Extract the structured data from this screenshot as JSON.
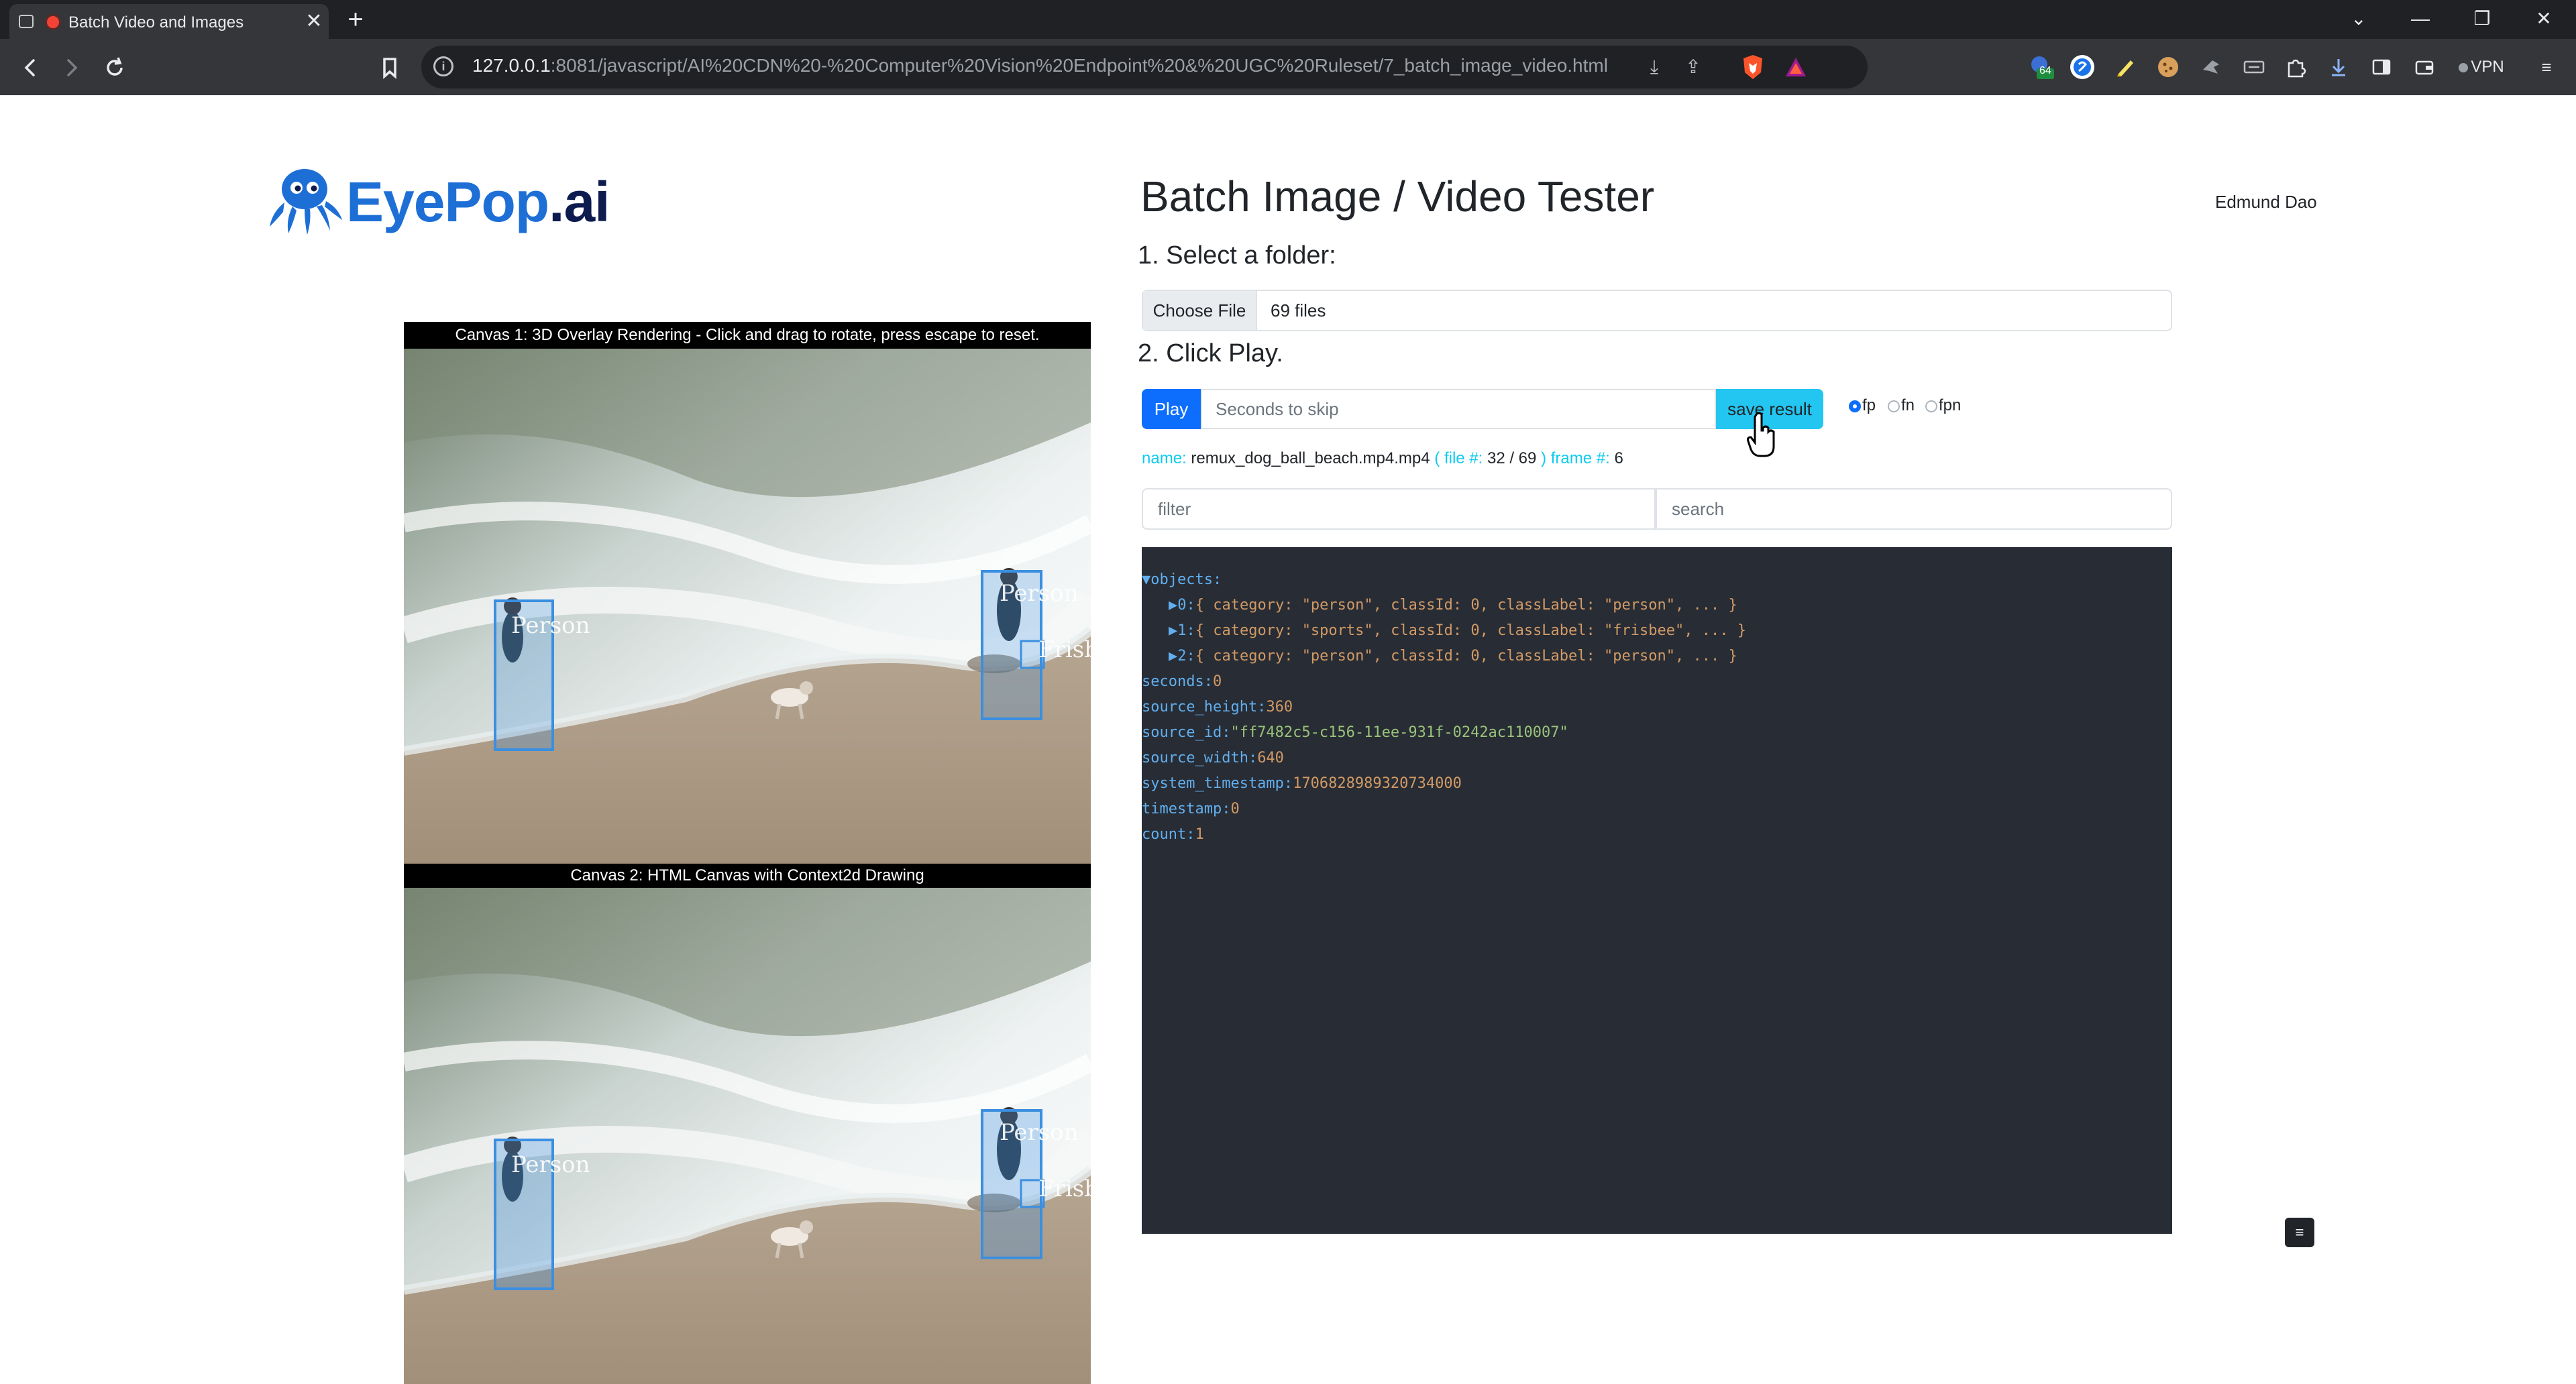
{
  "browser": {
    "tab_title": "Batch Video and Images",
    "tab_close": "✕",
    "new_tab": "+",
    "url_host": "127.0.0.1",
    "url_rest": ":8081/javascript/AI%20CDN%20-%20Computer%20Vision%20Endpoint%20&%20UGC%20Ruleset/7_batch_image_video.html",
    "info_icon": "i",
    "extension_badge": "64",
    "vpn_label": "VPN",
    "window_controls": [
      "⌄",
      "—",
      "❐",
      "✕"
    ],
    "accent_record": "#f44336"
  },
  "page": {
    "logo_eye": "EyePop",
    "logo_ai": ".ai",
    "title": "Batch Image / Video Tester",
    "user_name": "Edmund Dao",
    "step1": "1. Select a folder:",
    "choose_file": "Choose File",
    "file_count": "69 files",
    "step2": "2. Click Play.",
    "play_label": "Play",
    "skip_placeholder": "Seconds to skip",
    "save_label": "save result",
    "radios": [
      {
        "label": "fp",
        "checked": true
      },
      {
        "label": "fn",
        "checked": false
      },
      {
        "label": "fpn",
        "checked": false
      }
    ],
    "status": {
      "name_key": "name:",
      "name_val": "remux_dog_ball_beach.mp4.mp4",
      "file_open": "( file #:",
      "file_val": "32 / 69",
      "file_close": ")",
      "frame_key": "frame #:",
      "frame_val": "6"
    },
    "filter_placeholder": "filter",
    "search_placeholder": "search",
    "canvas1_label": "Canvas 1: 3D Overlay Rendering - Click and drag to rotate, press escape to reset.",
    "canvas2_label": "Canvas 2: HTML Canvas with Context2d Drawing",
    "overlay_labels": [
      "Person",
      "Person",
      "Frisbee"
    ],
    "scroll_button": "≡"
  },
  "json_view": {
    "objects_key": "▼objects:",
    "objects": [
      {
        "idx": "▶0:",
        "body": "{ category: \"person\", classId: 0, classLabel: \"person\", ... }"
      },
      {
        "idx": "▶1:",
        "body": "{ category: \"sports\", classId: 0, classLabel: \"frisbee\", ... }"
      },
      {
        "idx": "▶2:",
        "body": "{ category: \"person\", classId: 0, classLabel: \"person\", ... }"
      }
    ],
    "fields": [
      {
        "key": "seconds:",
        "val": "0",
        "kind": "num"
      },
      {
        "key": "source_height:",
        "val": "360",
        "kind": "num"
      },
      {
        "key": "source_id:",
        "val": "\"ff7482c5-c156-11ee-931f-0242ac110007\"",
        "kind": "str"
      },
      {
        "key": "source_width:",
        "val": "640",
        "kind": "num"
      },
      {
        "key": "system_timestamp:",
        "val": "1706828989320734000",
        "kind": "num"
      },
      {
        "key": "timestamp:",
        "val": "0",
        "kind": "num"
      },
      {
        "key": "count:",
        "val": "1",
        "kind": "num"
      }
    ]
  }
}
